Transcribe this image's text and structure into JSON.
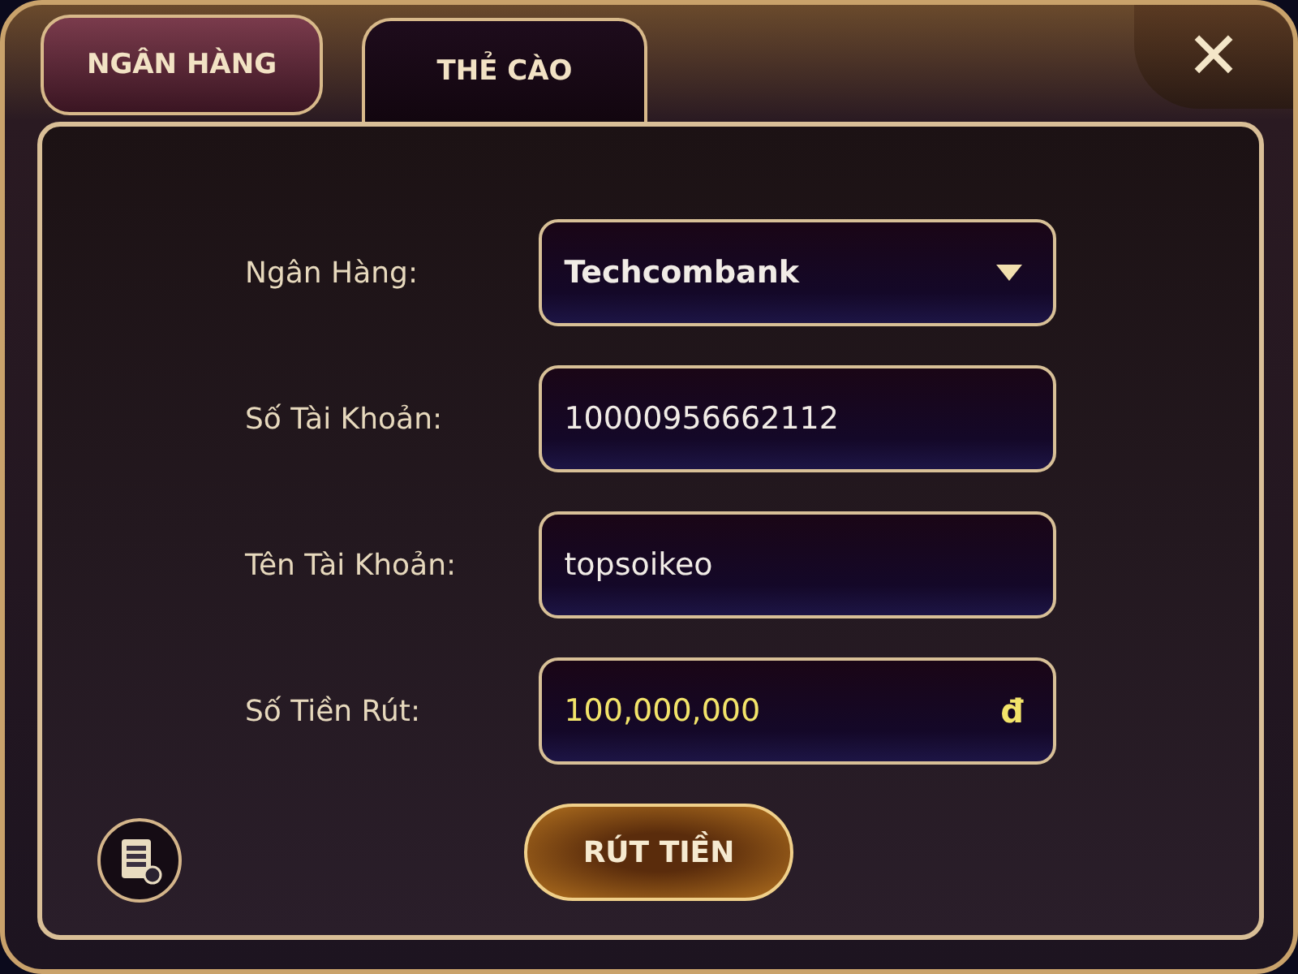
{
  "tabs": [
    {
      "label": "NGÂN HÀNG",
      "selected": true
    },
    {
      "label": "THẺ CÀO",
      "selected": false
    }
  ],
  "close": {
    "label": "✕"
  },
  "form": {
    "fields": [
      {
        "kind": "select",
        "label": "Ngân Hàng:",
        "value": "Techcombank"
      },
      {
        "kind": "text",
        "label": "Số Tài Khoản:",
        "value": "10000956662112"
      },
      {
        "kind": "text",
        "label": "Tên Tài Khoản:",
        "value": "topsoikeo"
      },
      {
        "kind": "amount",
        "label": "Số Tiền Rút:",
        "value": "100,000,000",
        "unit": "đ"
      }
    ]
  },
  "submit": {
    "label": "RÚT TIỀN"
  }
}
